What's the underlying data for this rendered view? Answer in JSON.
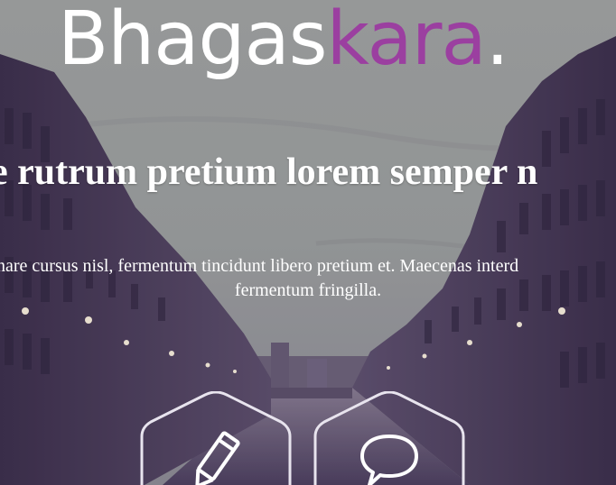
{
  "brand": {
    "name_main": "Bhagas",
    "name_accent": "kara",
    "name_dot": ".",
    "accent_color": "#9b3fa0"
  },
  "hero": {
    "headline": "e rutrum pretium lorem semper n",
    "description_line1": "nare cursus nisl, fermentum tincidunt libero pretium et. Maecenas interd",
    "description_line2": "fermentum fringilla."
  },
  "features": [
    {
      "icon": "pencil-icon"
    },
    {
      "icon": "speech-bubble-icon"
    }
  ]
}
